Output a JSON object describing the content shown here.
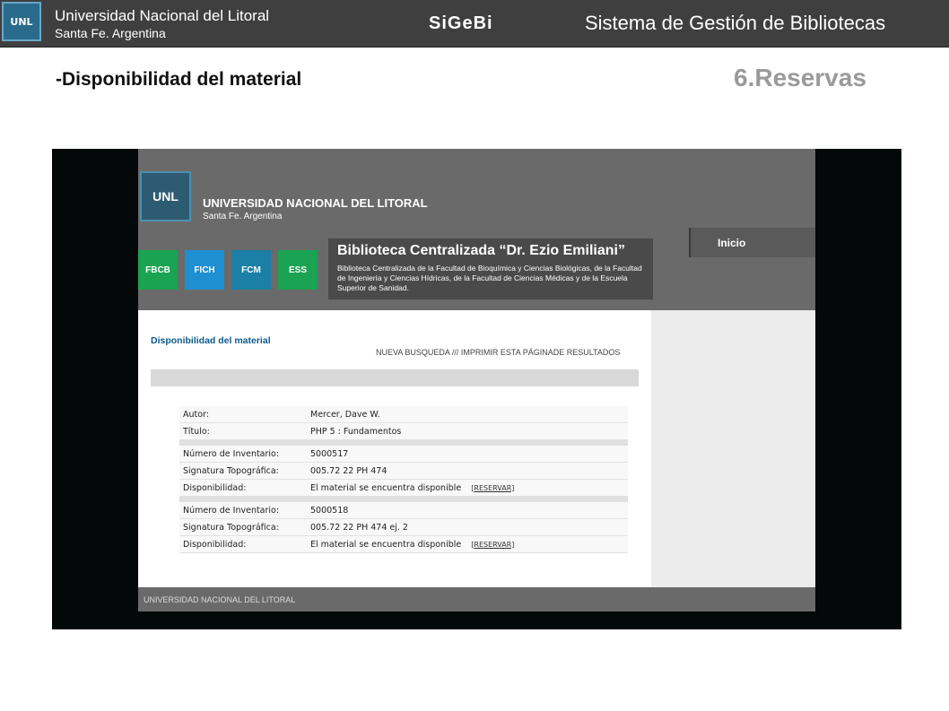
{
  "header": {
    "logo_text": "UNL",
    "university": "Universidad Nacional del Litoral",
    "city": "Santa Fe. Argentina",
    "product": "SiGeBi",
    "system": "Sistema de Gestión de Bibliotecas"
  },
  "slide": {
    "title": "-Disponibilidad del material",
    "section": "6.Reservas"
  },
  "site": {
    "logo_text": "UNL",
    "university": "UNIVERSIDAD NACIONAL DEL LITORAL",
    "city": "Santa Fe. Argentina",
    "faculties": [
      "FBCB",
      "FICH",
      "FCM",
      "ESS"
    ],
    "library_title": "Biblioteca Centralizada “Dr. Ezio Emiliani”",
    "library_desc": "Biblioteca Centralizada de la Facultad de Bioquímica y Ciencias Biológicas, de la Facultad de Ingeniería y Ciencias Hídricas, de la Facultad de Ciencias Médicas y de la Escuela Superior de Sanidad.",
    "nav_button": "Inicio",
    "page_heading": "Disponibilidad del material",
    "links": "NUEVA BUSQUEDA /// IMPRIMIR ESTA PÁGINADE RESULTADOS",
    "footer": "UNIVERSIDAD NACIONAL DEL LITORAL",
    "record": {
      "author_label": "Autor:",
      "author": "Mercer, Dave W.",
      "title_label": "Título:",
      "title": "PHP 5 : Fundamentos",
      "items": [
        {
          "inv_label": "Número de Inventario:",
          "inv": "5000517",
          "sig_label": "Signatura Topográfica:",
          "sig": "005.72 22 PH 474",
          "disp_label": "Disponibilidad:",
          "disp": "El material se encuentra disponible",
          "action": "[RESERVAR]"
        },
        {
          "inv_label": "Número de Inventario:",
          "inv": "5000518",
          "sig_label": "Signatura Topográfica:",
          "sig": "005.72 22 PH 474 ej. 2",
          "disp_label": "Disponibilidad:",
          "disp": "El material se encuentra disponible",
          "action": "[RESERVAR]"
        }
      ]
    }
  }
}
